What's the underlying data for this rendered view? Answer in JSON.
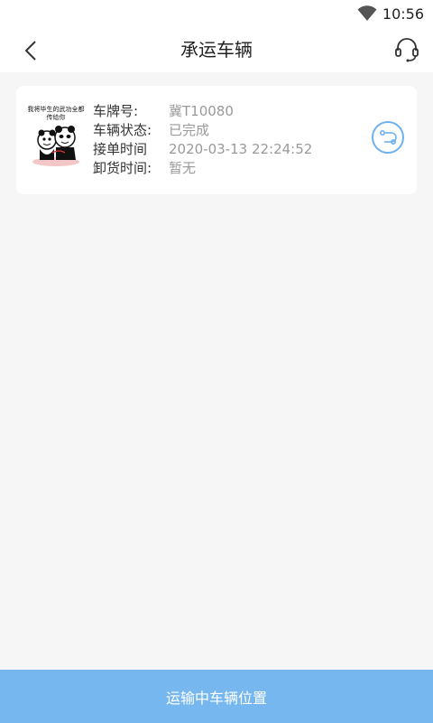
{
  "status_bar": {
    "time": "10:56"
  },
  "header": {
    "title": "承运车辆"
  },
  "vehicle": {
    "thumbnail_caption": "我将毕生的武功全都传给你",
    "fields": [
      {
        "label": "车牌号:",
        "value": "冀T10080"
      },
      {
        "label": "车辆状态:",
        "value": "已完成"
      },
      {
        "label": "接单时间",
        "value": "2020-03-13 22:24:52"
      },
      {
        "label": "卸货时间:",
        "value": "暂无"
      }
    ]
  },
  "footer": {
    "button_label": "运输中车辆位置"
  },
  "colors": {
    "accent": "#76b7f0",
    "route_icon": "#6fb1ee"
  }
}
